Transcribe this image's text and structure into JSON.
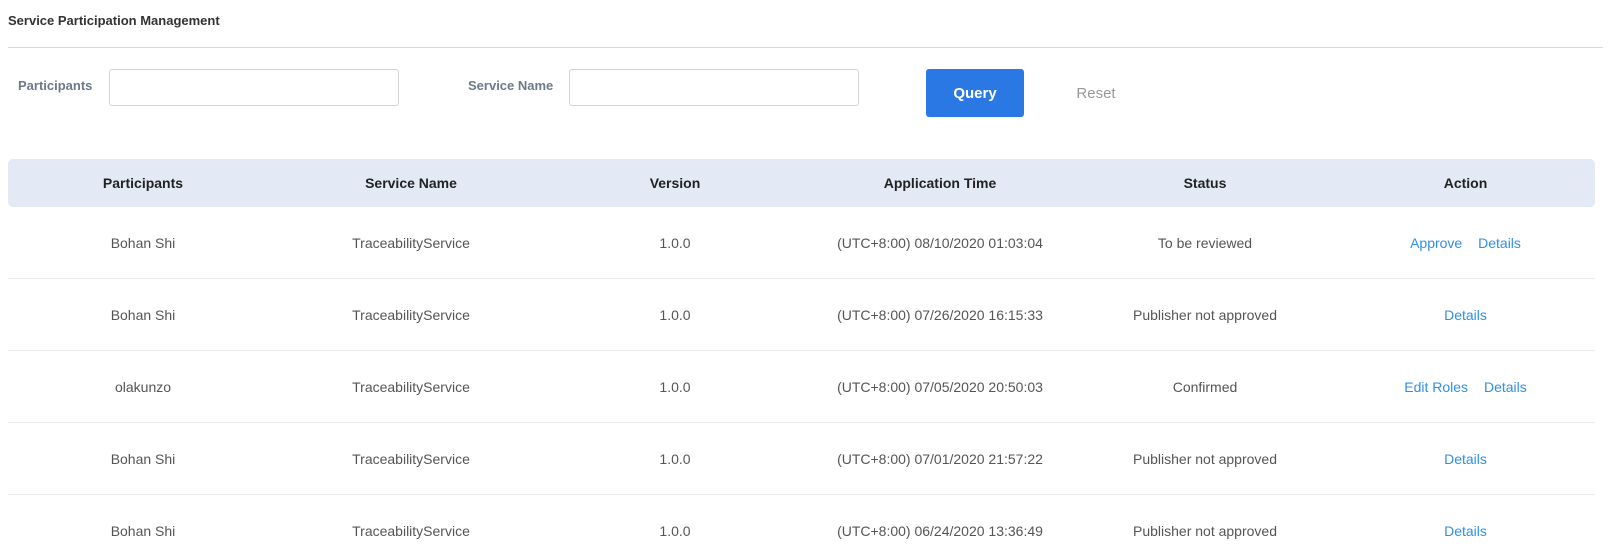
{
  "page": {
    "title": "Service Participation Management"
  },
  "filters": {
    "participants_label": "Participants",
    "participants_value": "",
    "service_name_label": "Service Name",
    "service_name_value": "",
    "query_label": "Query",
    "reset_label": "Reset"
  },
  "table": {
    "columns": [
      "Participants",
      "Service Name",
      "Version",
      "Application Time",
      "Status",
      "Action"
    ],
    "rows": [
      {
        "participant": "Bohan Shi",
        "service": "TraceabilityService",
        "version": "1.0.0",
        "time": "(UTC+8:00) 08/10/2020 01:03:04",
        "status": "To be reviewed",
        "actions": [
          "Approve",
          "Details"
        ]
      },
      {
        "participant": "Bohan Shi",
        "service": "TraceabilityService",
        "version": "1.0.0",
        "time": "(UTC+8:00) 07/26/2020 16:15:33",
        "status": "Publisher not approved",
        "actions": [
          "Details"
        ]
      },
      {
        "participant": "olakunzo",
        "service": "TraceabilityService",
        "version": "1.0.0",
        "time": "(UTC+8:00) 07/05/2020 20:50:03",
        "status": "Confirmed",
        "actions": [
          "Edit Roles",
          "Details"
        ]
      },
      {
        "participant": "Bohan Shi",
        "service": "TraceabilityService",
        "version": "1.0.0",
        "time": "(UTC+8:00) 07/01/2020 21:57:22",
        "status": "Publisher not approved",
        "actions": [
          "Details"
        ]
      },
      {
        "participant": "Bohan Shi",
        "service": "TraceabilityService",
        "version": "1.0.0",
        "time": "(UTC+8:00) 06/24/2020 13:36:49",
        "status": "Publisher not approved",
        "actions": [
          "Details"
        ]
      }
    ]
  },
  "colors": {
    "primary": "#2a78e4",
    "link": "#2f8fe8",
    "header_bg": "#e3eaf6"
  }
}
